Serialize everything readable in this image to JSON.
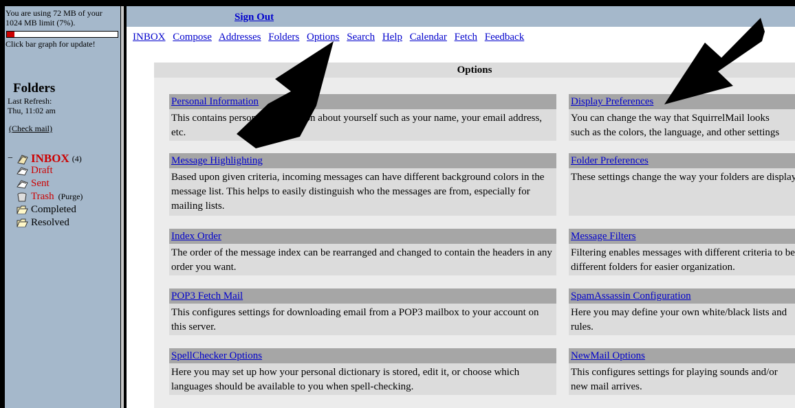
{
  "sidebar": {
    "quota_text": "You are using 72 MB of your 1024 MB limit (7%).",
    "quota_percent": 7,
    "quota_color": "#cc0000",
    "quota_hint": "Click bar graph for update!",
    "folders_title": "Folders",
    "last_refresh_label": "Last Refresh:",
    "last_refresh_time": "Thu, 11:02 am",
    "check_mail": "(Check mail)",
    "collapse_symbol": "−",
    "folders": [
      {
        "name": "INBOX",
        "count": "(4)",
        "icon": "inbox-icon"
      },
      {
        "name": "Draft",
        "icon": "draft-icon"
      },
      {
        "name": "Sent",
        "icon": "sent-icon"
      },
      {
        "name": "Trash",
        "purge": "(Purge)",
        "icon": "trash-icon"
      },
      {
        "name": "Completed",
        "icon": "folder-icon"
      },
      {
        "name": "Resolved",
        "icon": "folder-icon"
      }
    ]
  },
  "header": {
    "sign_out": "Sign Out",
    "nav": [
      "INBOX",
      "Compose",
      "Addresses",
      "Folders",
      "Options",
      "Search",
      "Help",
      "Calendar",
      "Fetch",
      "Feedback"
    ]
  },
  "options": {
    "title": "Options",
    "left": [
      {
        "title": "Personal Information",
        "desc": "This contains personal information about yourself such as your name, your email address, etc."
      },
      {
        "title": "Message Highlighting",
        "desc": "Based upon given criteria, incoming messages can have different background colors in the message list. This helps to easily distinguish who the messages are from, especially for mailing lists."
      },
      {
        "title": "Index Order",
        "desc": "The order of the message index can be rearranged and changed to contain the headers in any order you want."
      },
      {
        "title": "POP3 Fetch Mail",
        "desc": "This configures settings for downloading email from a POP3 mailbox to your account on this server."
      },
      {
        "title": "SpellChecker Options",
        "desc": "Here you may set up how your personal dictionary is stored, edit it, or choose which languages should be available to you when spell-checking."
      }
    ],
    "right": [
      {
        "title": "Display Preferences",
        "line1": "You can change the way that SquirrelMail looks",
        "line2": "such as the colors, the language, and other settings"
      },
      {
        "title": "Folder Preferences",
        "line1": "These settings change the way your folders are displayed",
        "line2": ""
      },
      {
        "title": "Message Filters",
        "line1": "Filtering enables messages with different criteria to be",
        "line2": "different folders for easier organization."
      },
      {
        "title": "SpamAssassin Configuration",
        "line1": "Here you may define your own white/black lists and",
        "line2": "rules."
      },
      {
        "title": "NewMail Options",
        "line1": "This configures settings for playing sounds and/or",
        "line2": "new mail arrives."
      }
    ]
  },
  "colors": {
    "sidebar_bg": "#a5b8cb",
    "card_title_bg": "#a6a6a6",
    "card_desc_bg": "#dcdcdc",
    "link": "#0000cc",
    "folder_link": "#cc0000"
  }
}
